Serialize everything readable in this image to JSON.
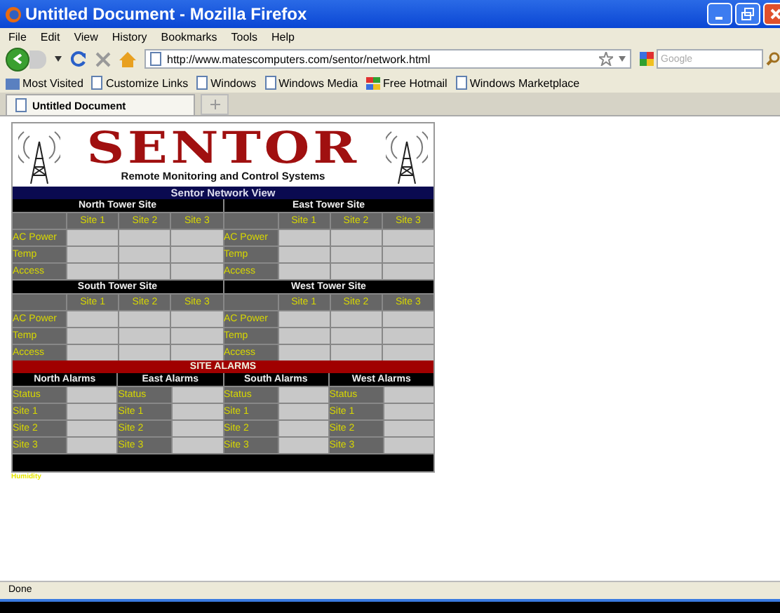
{
  "window": {
    "title": "Untitled Document - Mozilla Firefox"
  },
  "menu": [
    "File",
    "Edit",
    "View",
    "History",
    "Bookmarks",
    "Tools",
    "Help"
  ],
  "address": {
    "value": "http://www.matescomputers.com/sentor/network.html"
  },
  "search": {
    "placeholder": "Google"
  },
  "bookmarks": [
    {
      "label": "Most Visited",
      "kind": "folder"
    },
    {
      "label": "Customize Links",
      "kind": "page"
    },
    {
      "label": "Windows",
      "kind": "page"
    },
    {
      "label": "Windows Media",
      "kind": "page"
    },
    {
      "label": "Free Hotmail",
      "kind": "flag"
    },
    {
      "label": "Windows Marketplace",
      "kind": "page"
    }
  ],
  "tabs": [
    {
      "label": "Untitled Document",
      "selected": true
    }
  ],
  "page": {
    "logo": "SENTOR",
    "subtitle": "Remote Monitoring and Control Systems",
    "network_title": "Sentor Network View",
    "towers": [
      {
        "name": "North Tower Site",
        "columns": [
          "Site 1",
          "Site 2",
          "Site 3"
        ],
        "rows": [
          "AC Power",
          "Temp",
          "Access"
        ]
      },
      {
        "name": "East Tower Site",
        "columns": [
          "Site 1",
          "Site 2",
          "Site 3"
        ],
        "rows": [
          "AC Power",
          "Temp",
          "Access"
        ]
      },
      {
        "name": "South Tower Site",
        "columns": [
          "Site 1",
          "Site 2",
          "Site 3"
        ],
        "rows": [
          "AC Power",
          "Temp",
          "Access"
        ]
      },
      {
        "name": "West Tower Site",
        "columns": [
          "Site 1",
          "Site 2",
          "Site 3"
        ],
        "rows": [
          "AC Power",
          "Temp",
          "Access"
        ]
      }
    ],
    "alarms_title": "SITE ALARMS",
    "alarms": [
      {
        "name": "North Alarms",
        "rows": [
          "Status",
          "Site 1",
          "Site 2",
          "Site 3"
        ]
      },
      {
        "name": "East Alarms",
        "rows": [
          "Status",
          "Site 1",
          "Site 2",
          "Site 3"
        ]
      },
      {
        "name": "South Alarms",
        "rows": [
          "Status",
          "Site 1",
          "Site 2",
          "Site 3"
        ]
      },
      {
        "name": "West Alarms",
        "rows": [
          "Status",
          "Site 1",
          "Site 2",
          "Site 3"
        ]
      }
    ],
    "footnote": "Humidity"
  },
  "status_bar": "Done"
}
